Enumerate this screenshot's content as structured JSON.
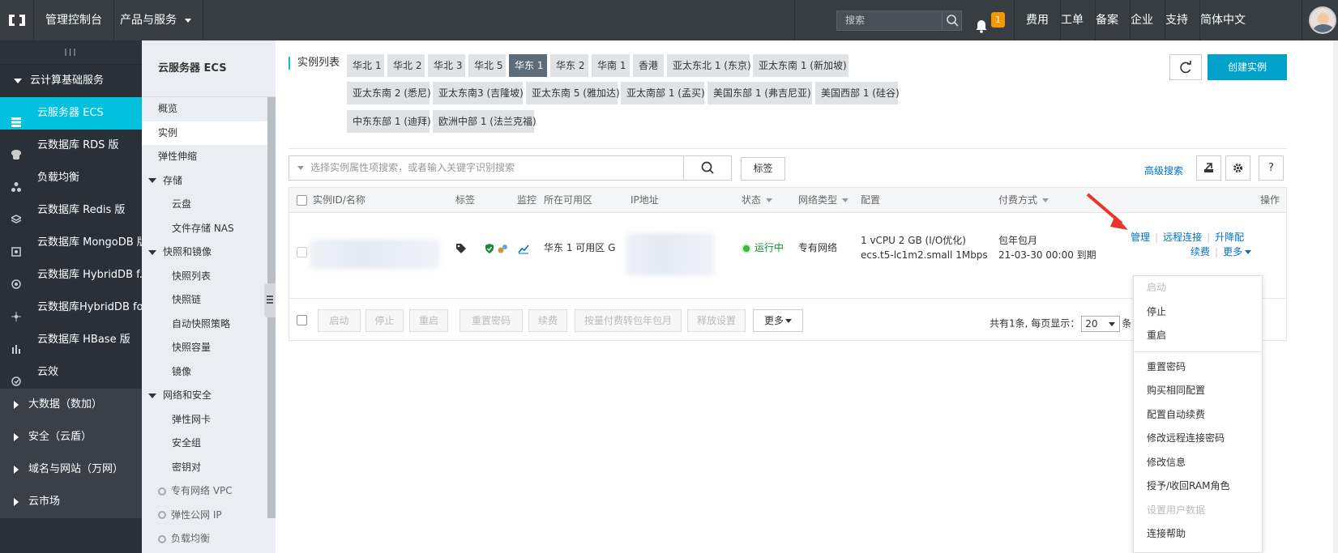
{
  "topbar": {
    "console": "管理控制台",
    "products": "产品与服务",
    "search_placeholder": "搜索",
    "notification_count": "1",
    "links": [
      "费用",
      "工单",
      "备案",
      "企业",
      "支持",
      "简体中文"
    ]
  },
  "sidebar": {
    "handle": "III",
    "group_main": "云计算基础服务",
    "items": [
      {
        "label": "云服务器 ECS",
        "icon": "server-icon"
      },
      {
        "label": "云数据库 RDS 版",
        "icon": "database-icon"
      },
      {
        "label": "负载均衡",
        "icon": "load-balancer-icon"
      },
      {
        "label": "云数据库 Redis 版",
        "icon": "redis-icon"
      },
      {
        "label": "云数据库 MongoDB 版",
        "icon": "mongodb-icon"
      },
      {
        "label": "云数据库 HybridDB f...",
        "icon": "hybriddb-icon"
      },
      {
        "label": "云数据库HybridDB fo...",
        "icon": "hybriddb-mysql-icon"
      },
      {
        "label": "云数据库 HBase 版",
        "icon": "hbase-icon"
      },
      {
        "label": "云效",
        "icon": "yunxiao-icon"
      }
    ],
    "collapsed_groups": [
      "大数据（数加）",
      "安全（云盾）",
      "域名与网站（万网）",
      "云市场"
    ]
  },
  "subnav": {
    "title": "云服务器 ECS",
    "items": [
      {
        "label": "概览",
        "type": "item"
      },
      {
        "label": "实例",
        "type": "active"
      },
      {
        "label": "弹性伸缩",
        "type": "item"
      },
      {
        "label": "存储",
        "type": "group"
      },
      {
        "label": "云盘",
        "type": "sub"
      },
      {
        "label": "文件存储 NAS",
        "type": "sub"
      },
      {
        "label": "快照和镜像",
        "type": "group"
      },
      {
        "label": "快照列表",
        "type": "sub"
      },
      {
        "label": "快照链",
        "type": "sub"
      },
      {
        "label": "自动快照策略",
        "type": "sub"
      },
      {
        "label": "快照容量",
        "type": "sub"
      },
      {
        "label": "镜像",
        "type": "sub"
      },
      {
        "label": "网络和安全",
        "type": "group"
      },
      {
        "label": "弹性网卡",
        "type": "sub"
      },
      {
        "label": "安全组",
        "type": "sub"
      },
      {
        "label": "密钥对",
        "type": "sub"
      },
      {
        "label": "专有网络 VPC",
        "type": "link"
      },
      {
        "label": "弹性公网 IP",
        "type": "link"
      },
      {
        "label": "负载均衡",
        "type": "link"
      }
    ]
  },
  "main": {
    "list_label": "实例列表",
    "regions_row1": [
      "华北 1",
      "华北 2",
      "华北 3",
      "华北 5",
      "华东 1",
      "华东 2",
      "华南 1",
      "香港",
      "亚太东北 1 (东京)",
      "亚太东南 1 (新加坡)"
    ],
    "regions_row2": [
      "亚太东南 2 (悉尼)",
      "亚太东南3 (吉隆坡)",
      "亚太东南 5 (雅加达)",
      "亚太南部 1 (孟买)",
      "美国东部 1 (弗吉尼亚)",
      "美国西部 1 (硅谷)"
    ],
    "regions_row3": [
      "中东东部 1 (迪拜)",
      "欧洲中部 1 (法兰克福)"
    ],
    "active_region": "华东 1",
    "create_button": "创建实例",
    "search_placeholder": "选择实例属性项搜索，或者输入关键字识别搜索",
    "tag_button": "标签",
    "advanced_search": "高级搜索",
    "help_button": "?",
    "columns": [
      "实例ID/名称",
      "标签",
      "监控",
      "所在可用区",
      "IP地址",
      "状态",
      "网络类型",
      "配置",
      "付费方式",
      "操作"
    ],
    "row": {
      "zone": "华东 1 可用区 G",
      "status": "运行中",
      "network": "专有网络",
      "config_line1": "1 vCPU 2 GB (I/O优化)",
      "config_line2": "ecs.t5-lc1m2.small   1Mbps",
      "pay_line1": "包年包月",
      "pay_line2": "21-03-30 00:00 到期",
      "op_manage": "管理",
      "op_remote": "远程连接",
      "op_upgrade": "升降配",
      "op_renew": "续费",
      "op_more": "更多"
    },
    "footer_buttons": [
      "启动",
      "停止",
      "重启",
      "重置密码",
      "续费",
      "按量付费转包年包月",
      "释放设置",
      "更多"
    ],
    "pager_prefix": "共有1条, 每页显示：",
    "pager_size": "20",
    "pager_suffix": "条"
  },
  "dropdown": {
    "group1": [
      {
        "label": "启动",
        "disabled": true
      },
      {
        "label": "停止",
        "disabled": false
      },
      {
        "label": "重启",
        "disabled": false
      }
    ],
    "group2": [
      {
        "label": "重置密码",
        "disabled": false
      },
      {
        "label": "购买相同配置",
        "disabled": false
      },
      {
        "label": "配置自动续费",
        "disabled": false
      },
      {
        "label": "修改远程连接密码",
        "disabled": false
      },
      {
        "label": "修改信息",
        "disabled": false
      },
      {
        "label": "授予/收回RAM角色",
        "disabled": false
      },
      {
        "label": "设置用户数据",
        "disabled": true
      },
      {
        "label": "连接帮助",
        "disabled": false
      }
    ]
  },
  "colors": {
    "accent": "#00c1de",
    "topbar": "#373d41",
    "sidebar": "#293038",
    "link": "#0070cc",
    "create": "#00a2ca",
    "annotation_arrow": "#e8352b"
  }
}
